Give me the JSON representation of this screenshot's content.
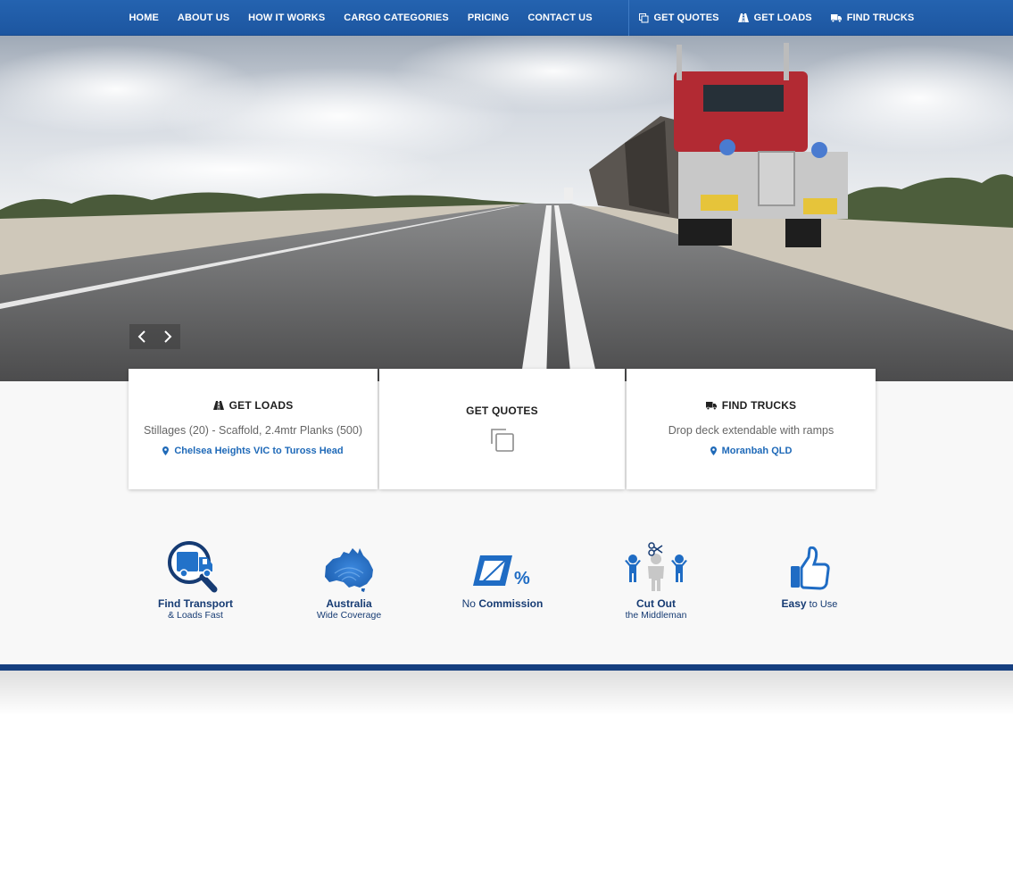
{
  "nav": {
    "left": [
      {
        "label": "HOME"
      },
      {
        "label": "ABOUT US"
      },
      {
        "label": "HOW IT WORKS"
      },
      {
        "label": "CARGO CATEGORIES"
      },
      {
        "label": "PRICING"
      },
      {
        "label": "CONTACT US"
      }
    ],
    "right": [
      {
        "label": "GET QUOTES",
        "icon": "copy-icon"
      },
      {
        "label": "GET LOADS",
        "icon": "road-icon"
      },
      {
        "label": "FIND TRUCKS",
        "icon": "truck-icon"
      }
    ]
  },
  "slider": {
    "prev_icon": "chevron-left-icon",
    "next_icon": "chevron-right-icon"
  },
  "cards": [
    {
      "title": "GET LOADS",
      "icon": "road-icon",
      "description": "Stillages (20) - Scaffold, 2.4mtr Planks (500)",
      "location": "Chelsea Heights VIC to Tuross Head"
    },
    {
      "title": "GET QUOTES",
      "icon": "copy-icon"
    },
    {
      "title": "FIND TRUCKS",
      "icon": "truck-icon",
      "description": "Drop deck extendable with ramps",
      "location": "Moranbah QLD"
    }
  ],
  "features": [
    {
      "line1_bold": "Find Transport",
      "line1_rest": "",
      "line2": "& Loads Fast",
      "icon": "magnifier-truck-icon"
    },
    {
      "line1_bold": "Australia",
      "line1_rest": "",
      "line2": "Wide Coverage",
      "icon": "australia-map-icon"
    },
    {
      "line1_prefix": "No ",
      "line1_bold": "Commission",
      "line1_rest": "",
      "line2": "",
      "icon": "zero-percent-icon"
    },
    {
      "line1_bold": "Cut Out",
      "line1_rest": "",
      "line2": "the Middleman",
      "icon": "middleman-icon"
    },
    {
      "line1_bold": "Easy",
      "line1_rest": " to Use",
      "line2": "",
      "icon": "thumbs-up-icon"
    }
  ],
  "colors": {
    "nav_bg": "#2463b0",
    "accent": "#1e69b8",
    "footer_rule": "#163f80",
    "feature_text": "#163b73"
  }
}
